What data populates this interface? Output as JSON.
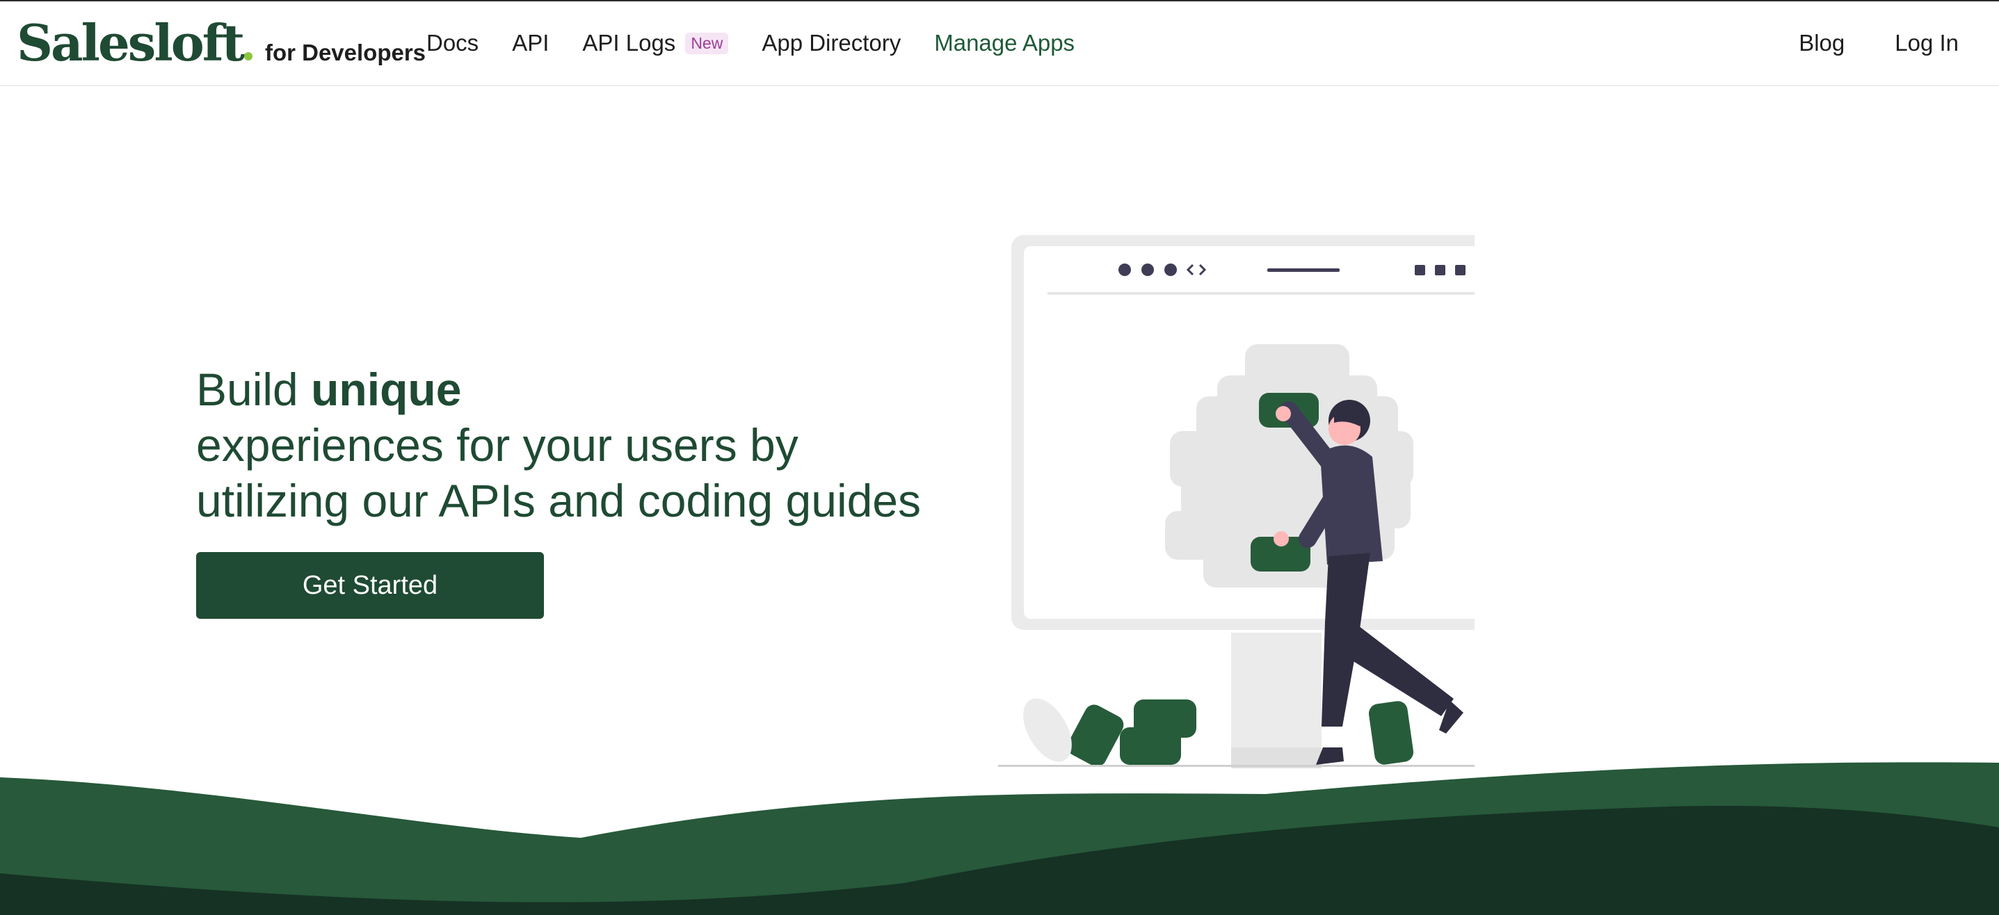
{
  "brand": {
    "logo": "Salesloft",
    "suffix": "for Developers"
  },
  "nav": {
    "left": [
      {
        "label": "Docs"
      },
      {
        "label": "API"
      },
      {
        "label": "API Logs",
        "badge": "New"
      },
      {
        "label": "App Directory"
      },
      {
        "label": "Manage Apps",
        "active": true
      }
    ],
    "right": [
      {
        "label": "Blog"
      },
      {
        "label": "Log In"
      }
    ]
  },
  "hero": {
    "line1_prefix": "Build",
    "line1_emphasis": "unique",
    "line2": "experiences for your users by",
    "line3": "utilizing our APIs and coding guides",
    "cta": "Get Started"
  },
  "illustration": {
    "name": "developer-building-app-illustration",
    "icons": [
      "code-icon"
    ]
  },
  "colors": {
    "brand_green": "#1f4a33",
    "accent_dot": "#8cc63f",
    "wave_mid": "#27593a",
    "wave_dark": "#163224",
    "badge_bg": "#f6e5f5",
    "badge_text": "#9b3f98"
  }
}
